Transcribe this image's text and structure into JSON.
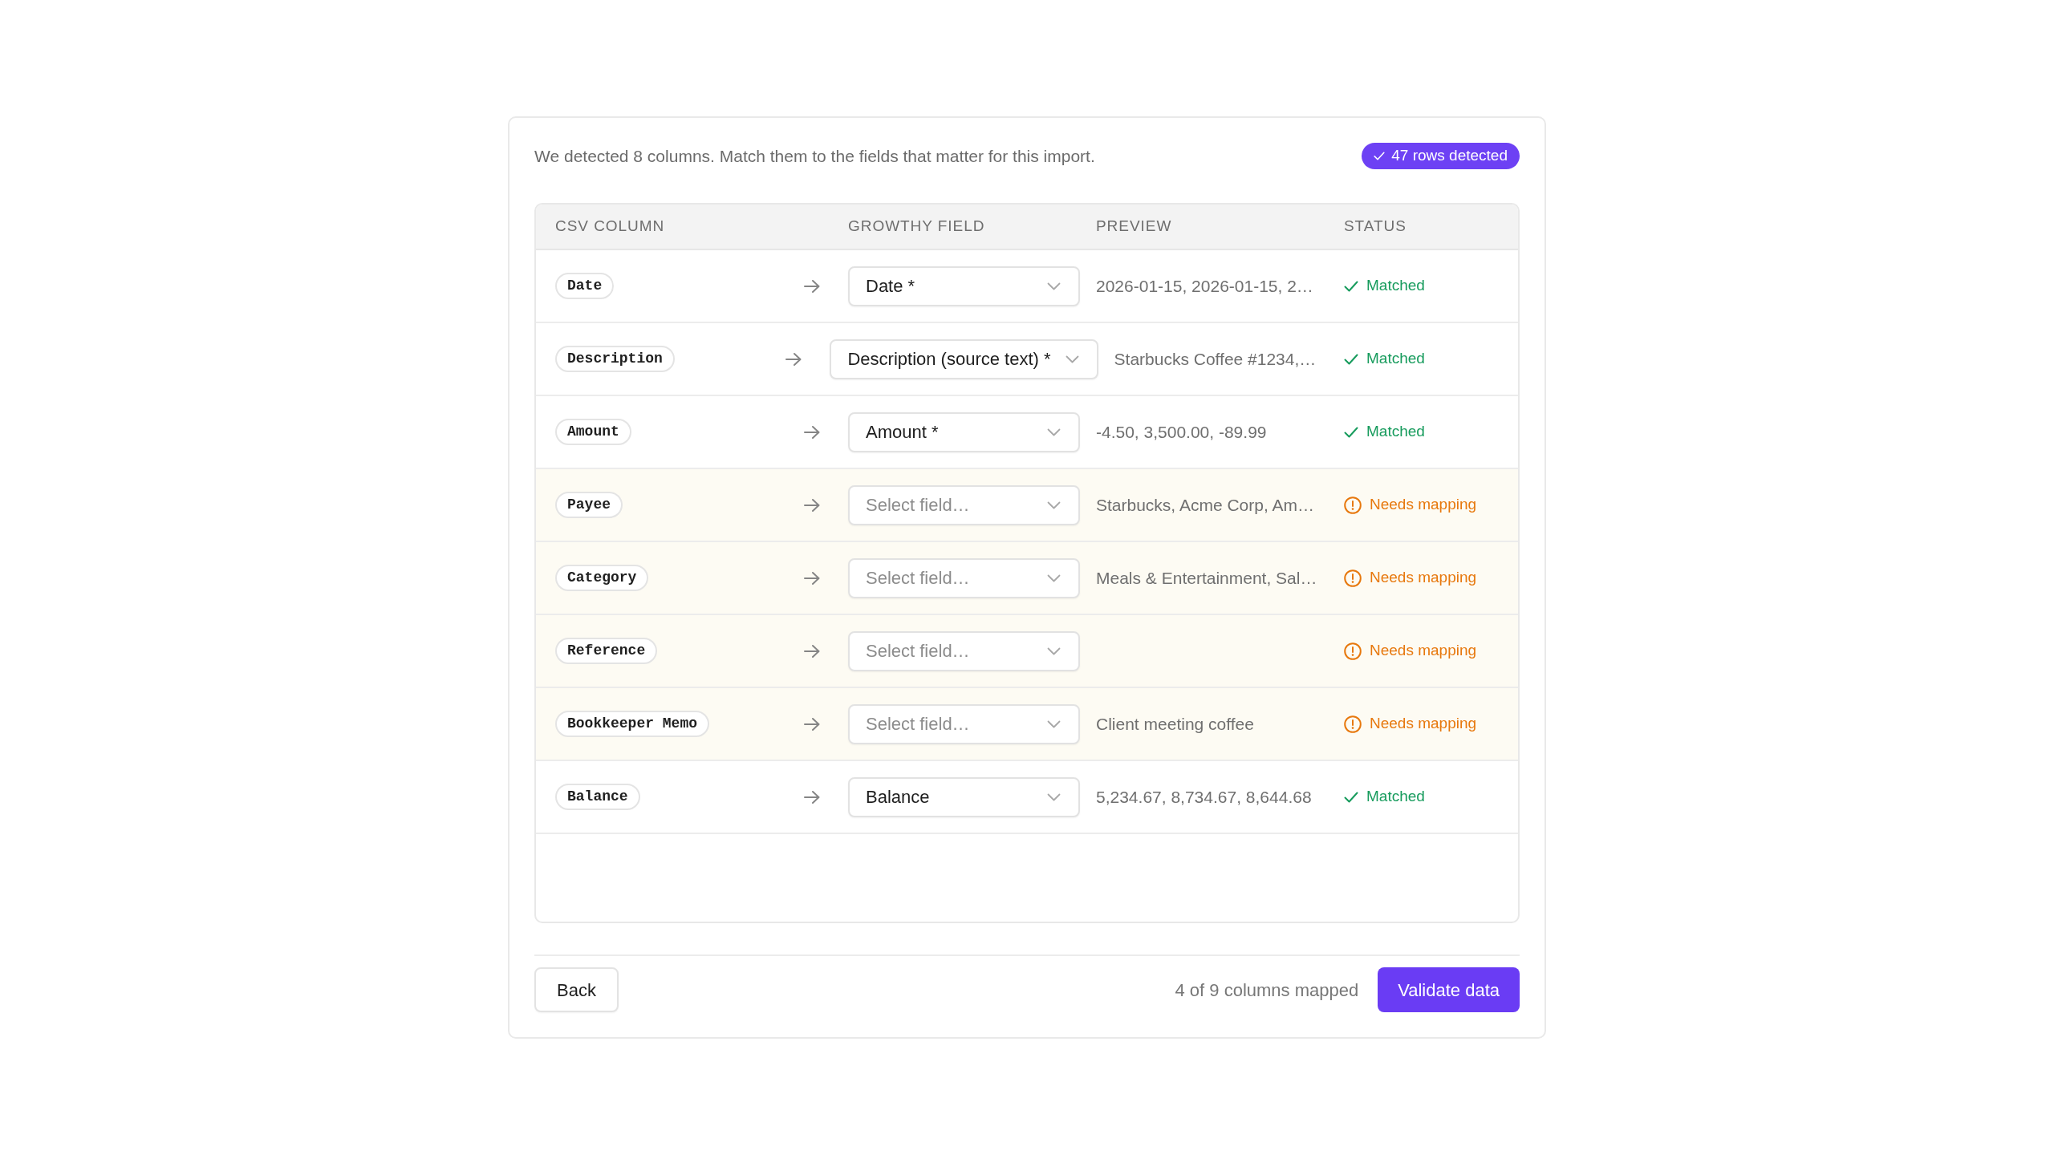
{
  "intro": "We detected 8 columns. Match them to the fields that matter for this import.",
  "rows_badge": {
    "label": "47 rows detected"
  },
  "table": {
    "columns": [
      "CSV COLUMN",
      "GROWTHY FIELD",
      "PREVIEW",
      "STATUS"
    ],
    "rows": [
      {
        "csv_column": "Date",
        "field": {
          "value": "Date *"
        },
        "preview": "2026-01-15, 2026-01-15, 2…",
        "status": {
          "kind": "matched",
          "label": "Matched"
        }
      },
      {
        "csv_column": "Description",
        "field": {
          "value": "Description (source text) *"
        },
        "preview": "Starbucks Coffee #1234,…",
        "status": {
          "kind": "matched",
          "label": "Matched"
        }
      },
      {
        "csv_column": "Amount",
        "field": {
          "value": "Amount *"
        },
        "preview": "-4.50, 3,500.00, -89.99",
        "status": {
          "kind": "matched",
          "label": "Matched"
        }
      },
      {
        "csv_column": "Payee",
        "field": {
          "placeholder": "Select field…"
        },
        "preview": "Starbucks, Acme Corp, Am…",
        "status": {
          "kind": "needs_mapping",
          "label": "Needs mapping"
        }
      },
      {
        "csv_column": "Category",
        "field": {
          "placeholder": "Select field…"
        },
        "preview": "Meals & Entertainment, Sal…",
        "status": {
          "kind": "needs_mapping",
          "label": "Needs mapping"
        }
      },
      {
        "csv_column": "Reference",
        "field": {
          "placeholder": "Select field…"
        },
        "status": {
          "kind": "needs_mapping",
          "label": "Needs mapping"
        }
      },
      {
        "csv_column": "Bookkeeper Memo",
        "field": {
          "placeholder": "Select field…"
        },
        "preview": "Client meeting coffee",
        "status": {
          "kind": "needs_mapping",
          "label": "Needs mapping"
        }
      },
      {
        "csv_column": "Balance",
        "field": {
          "value": "Balance"
        },
        "preview": "5,234.67, 8,734.67, 8,644.68",
        "status": {
          "kind": "matched",
          "label": "Matched"
        }
      }
    ]
  },
  "footer": {
    "back_button": "Back",
    "mapped_count": "4 of 9 columns mapped",
    "validate_button": "Validate data"
  }
}
